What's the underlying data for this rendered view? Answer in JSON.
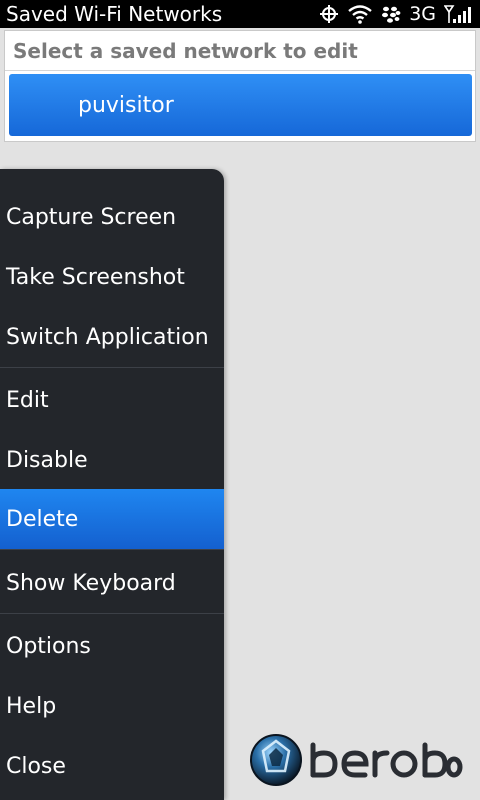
{
  "status": {
    "title": "Saved Wi-Fi Networks",
    "network_type": "3G",
    "icons": [
      "gps-icon",
      "wifi-icon",
      "blackberry-icon",
      "signal-strength-icon"
    ]
  },
  "panel": {
    "header": "Select a saved network to edit",
    "networks": [
      {
        "name": "puvisitor",
        "selected": true
      }
    ]
  },
  "menu": {
    "items": [
      {
        "label": "Capture Screen"
      },
      {
        "label": "Take Screenshot"
      },
      {
        "label": "Switch Application"
      },
      {
        "label": "Edit"
      },
      {
        "label": "Disable"
      },
      {
        "label": "Delete",
        "selected": true
      },
      {
        "label": "Show Keyboard"
      },
      {
        "label": "Options"
      },
      {
        "label": "Help"
      },
      {
        "label": "Close"
      }
    ]
  },
  "watermark": {
    "text": "berobo"
  },
  "colors": {
    "selection": "#1f7ae8",
    "menu_background": "#23262b",
    "page_background": "#e2e2e2"
  }
}
